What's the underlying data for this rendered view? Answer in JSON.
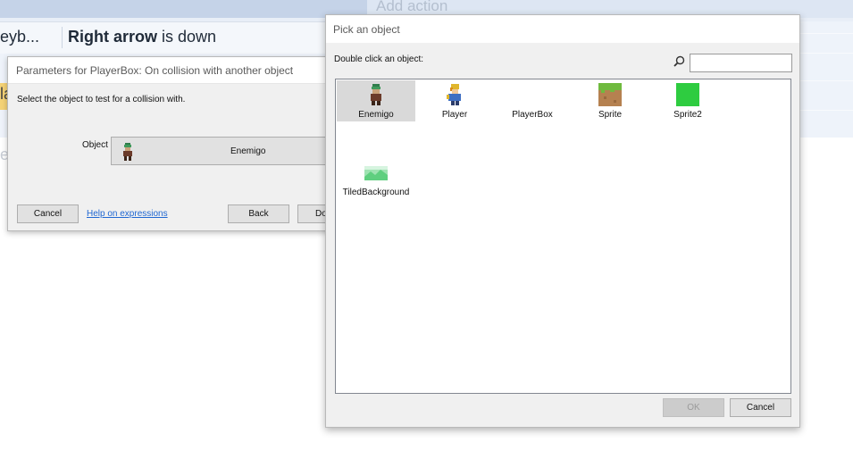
{
  "event_sheet": {
    "add_action_label": "Add action",
    "condition_keyboard_truncated": "eyb...",
    "condition_bold": "Right arrow",
    "condition_rest": " is down",
    "partial_left_letters": "la",
    "faded_letter": "e"
  },
  "param_dialog": {
    "title": "Parameters for PlayerBox: On collision with another object",
    "description": "Select the object to test for a collision with.",
    "object_label": "Object",
    "object_value": "Enemigo",
    "cancel_label": "Cancel",
    "help_link": "Help on expressions",
    "back_label": "Back",
    "done_label_partial": "Do"
  },
  "pick_dialog": {
    "title": "Pick an object",
    "hint": "Double click an object:",
    "search_value": "",
    "objects": [
      {
        "name": "Enemigo",
        "icon": "enemigo-sprite-icon",
        "selected": true
      },
      {
        "name": "Player",
        "icon": "player-sprite-icon",
        "selected": false
      },
      {
        "name": "PlayerBox",
        "icon": "empty-icon",
        "selected": false
      },
      {
        "name": "Sprite",
        "icon": "grass-block-icon",
        "selected": false
      },
      {
        "name": "Sprite2",
        "icon": "green-square-icon",
        "selected": false
      },
      {
        "name": "TiledBackground",
        "icon": "tiled-background-icon",
        "selected": false
      }
    ],
    "ok_label": "OK",
    "cancel_label": "Cancel"
  },
  "colors": {
    "selection": "#d9d9d9",
    "link": "#1f67d2",
    "green_square": "#2ecc40"
  }
}
